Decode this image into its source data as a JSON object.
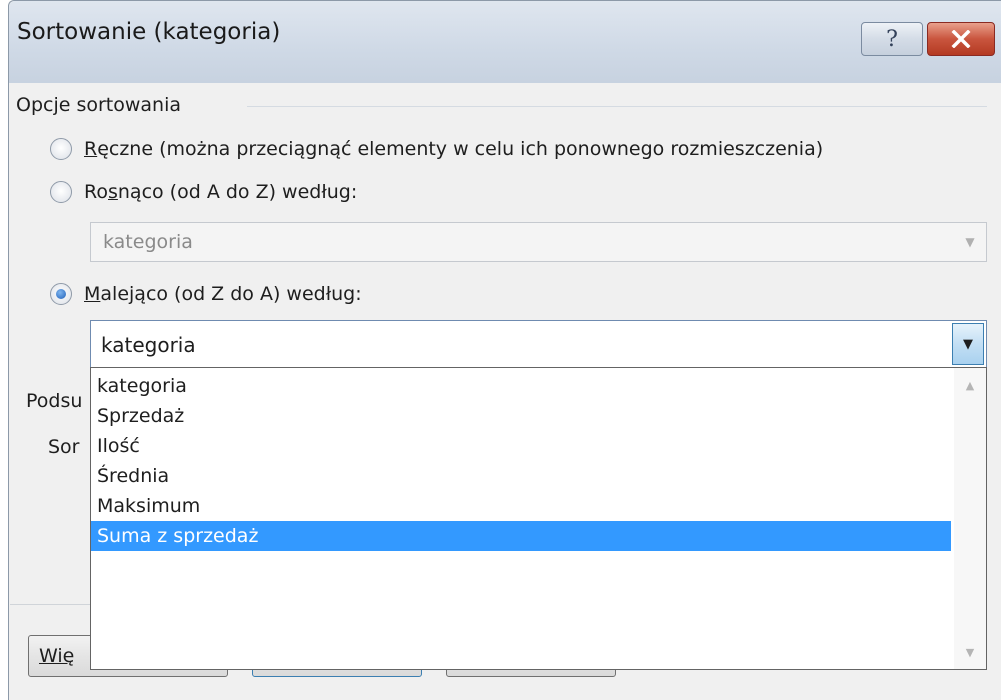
{
  "window": {
    "title": "Sortowanie (kategoria)",
    "help_label": "?",
    "close_icon": "close-icon"
  },
  "sort_options": {
    "group_label": "Opcje sortowania",
    "manual": {
      "mnemonic": "R",
      "rest": "ęczne (można przeciągnąć elementy w celu ich ponownego rozmieszczenia)",
      "checked": false
    },
    "ascending": {
      "pre": "Ro",
      "mnemonic": "s",
      "rest": "nąco (od A do Z) według:",
      "checked": false,
      "combo_value": "kategoria"
    },
    "descending": {
      "mnemonic": "M",
      "rest": "alejąco (od Z do A) według:",
      "checked": true,
      "combo_value": "kategoria"
    }
  },
  "dropdown": {
    "items": [
      "kategoria",
      "Sprzedaż",
      "Ilość",
      "Średnia",
      "Maksimum",
      "Suma z sprzedaż"
    ],
    "selected_index": 5,
    "selection_color": "#3399ff"
  },
  "background": {
    "summary_label_partial": "Podsu",
    "sort_label_partial": "Sor",
    "more_button_partial": "Wię"
  }
}
